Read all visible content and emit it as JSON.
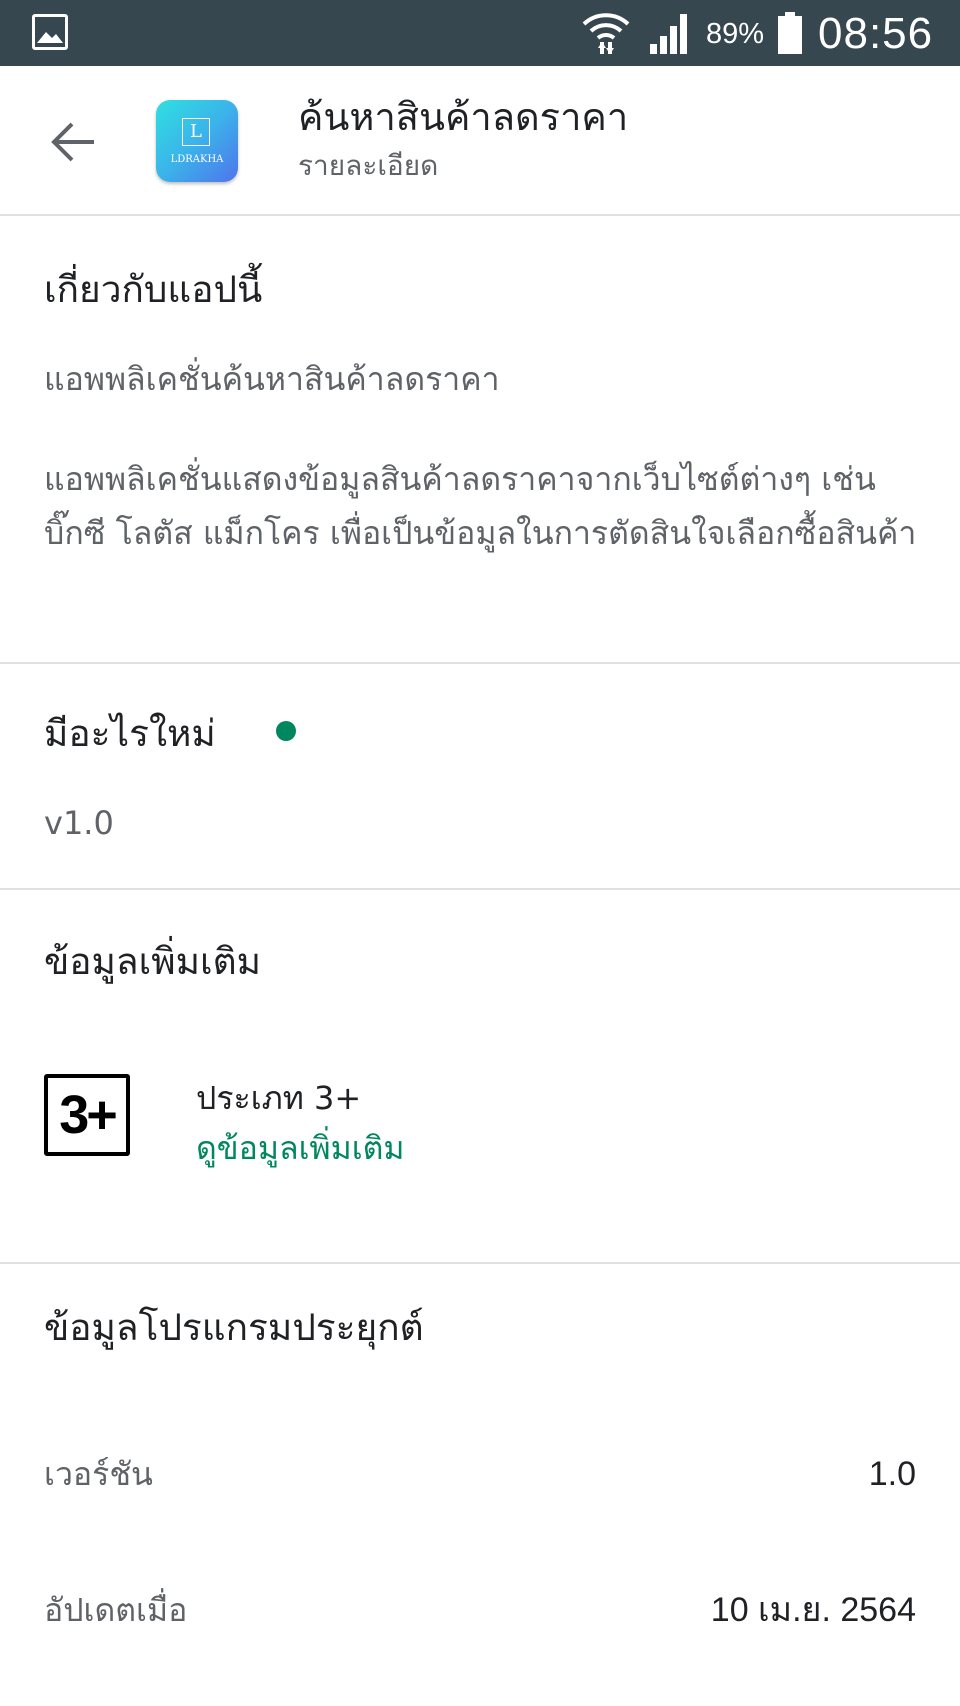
{
  "status_bar": {
    "battery_percent": "89%",
    "time": "08:56",
    "icons": [
      "gallery-icon",
      "wifi-icon",
      "signal-icon",
      "battery-icon"
    ]
  },
  "header": {
    "back_icon": "arrow-left-icon",
    "app_icon": {
      "letter": "L",
      "name": "LDRAKHA",
      "colors": [
        "#2fe0e0",
        "#4f74ec"
      ]
    },
    "title": "ค้นหาสินค้าลดราคา",
    "subtitle": "รายละเอียด"
  },
  "about": {
    "heading": "เกี่ยวกับแอปนี้",
    "short_description": "แอพพลิเคชั่นค้นหาสินค้าลดราคา",
    "long_description": "แอพพลิเคชั่นแสดงข้อมูลสินค้าลดราคาจากเว็บไซต์ต่างๆ เช่น บิ๊กซี โลตัส แม็กโคร เพื่อเป็นข้อมูลในการตัดสินใจเลือกซื้อสินค้า"
  },
  "whats_new": {
    "heading": "มีอะไรใหม่",
    "dot_color": "#01875f",
    "text": "v1.0"
  },
  "more_info": {
    "heading": "ข้อมูลเพิ่มเติม",
    "rating_badge": "3+",
    "rating_label": "ประเภท 3+",
    "rating_link": "ดูข้อมูลเพิ่มเติม",
    "link_color": "#01875f"
  },
  "app_info": {
    "heading": "ข้อมูลโปรแกรมประยุกต์",
    "rows": [
      {
        "label": "เวอร์ชัน",
        "value": "1.0"
      },
      {
        "label": "อัปเดตเมื่อ",
        "value": "10 เม.ย. 2564"
      }
    ]
  }
}
